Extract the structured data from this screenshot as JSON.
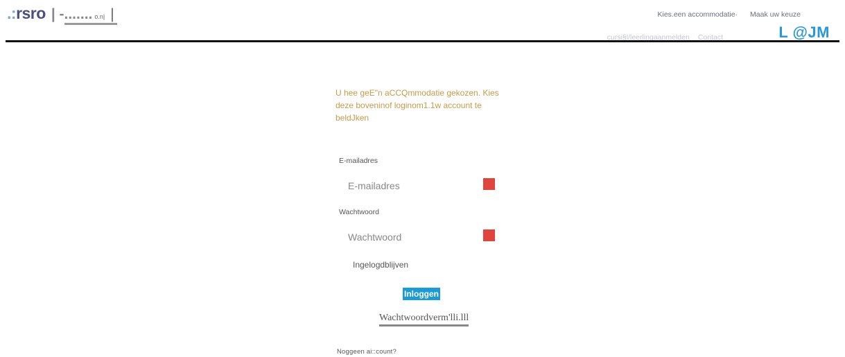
{
  "header": {
    "logo_dots": ".:",
    "logo_name": "rsro",
    "logo_sep": "| -.......",
    "logo_sub": "o.n|",
    "logo_bar": "|",
    "nav_top": [
      "Kies.een accommodatie·",
      "Maak uw keuze"
    ],
    "nav_sub": [
      "cursi§l/leerlingaanmelden",
      "Contact"
    ],
    "brand_right": "L @JM"
  },
  "main": {
    "notice": "U hee geE\"n aCCQmmodatie gekozen. Kies deze boveninof loginom1.1w account te beldJken",
    "email": {
      "label": "E-mailadres",
      "placeholder": "E-mailadres",
      "value": ""
    },
    "password": {
      "label": "Wachtwoord",
      "placeholder": "Wachtwoord",
      "value": ""
    },
    "remember_label": "Ingelogdblijven",
    "login_label": "Inloggen",
    "forgot_label": "Wachtwoordverm'lli.lll",
    "no_account": "Noggeen ai::count?"
  },
  "colors": {
    "accent": "#1a9bd8",
    "warning": "#e0453d",
    "notice": "#c79a4a",
    "brand": "#2899d6"
  },
  "icons": [
    "warning-icon",
    "warning-icon"
  ]
}
